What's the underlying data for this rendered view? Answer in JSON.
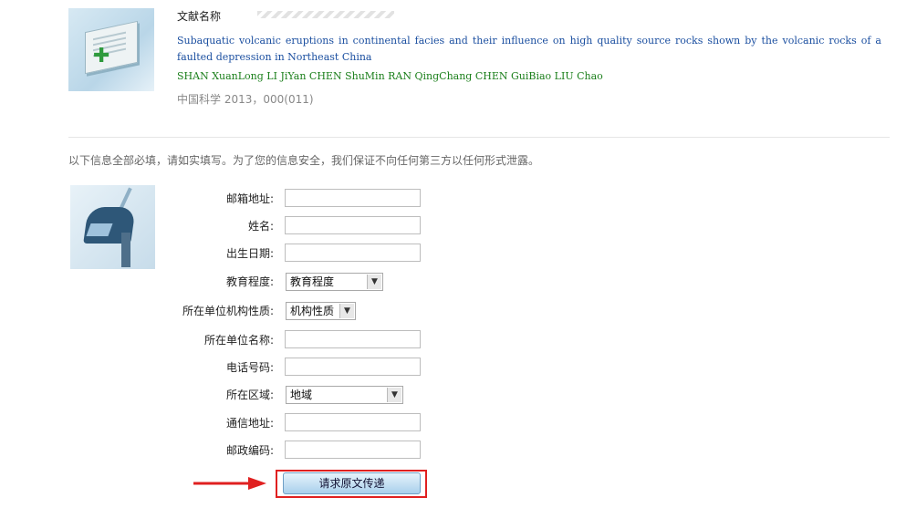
{
  "document": {
    "label": "文献名称",
    "title": "Subaquatic volcanic eruptions in continental facies and their influence on high quality source rocks shown by the volcanic rocks of a faulted depression in Northeast China",
    "authors": "SHAN XuanLong LI JiYan CHEN ShuMin RAN QingChang CHEN GuiBiao LIU Chao",
    "source": "中国科学 2013，000(011)"
  },
  "notice": "以下信息全部必填，请如实填写。为了您的信息安全，我们保证不向任何第三方以任何形式泄露。",
  "form": {
    "email_label": "邮箱地址:",
    "name_label": "姓名:",
    "birth_label": "出生日期:",
    "education_label": "教育程度:",
    "education_value": "教育程度",
    "org_type_label": "所在单位机构性质:",
    "org_type_value": "机构性质",
    "org_name_label": "所在单位名称:",
    "phone_label": "电话号码:",
    "region_label": "所在区域:",
    "region_value": "地域",
    "address_label": "通信地址:",
    "postcode_label": "邮政编码:",
    "submit_label": "请求原文传递"
  },
  "colors": {
    "title_blue": "#1b4fa0",
    "author_green": "#1b7f1b",
    "highlight_red": "#e02020"
  }
}
